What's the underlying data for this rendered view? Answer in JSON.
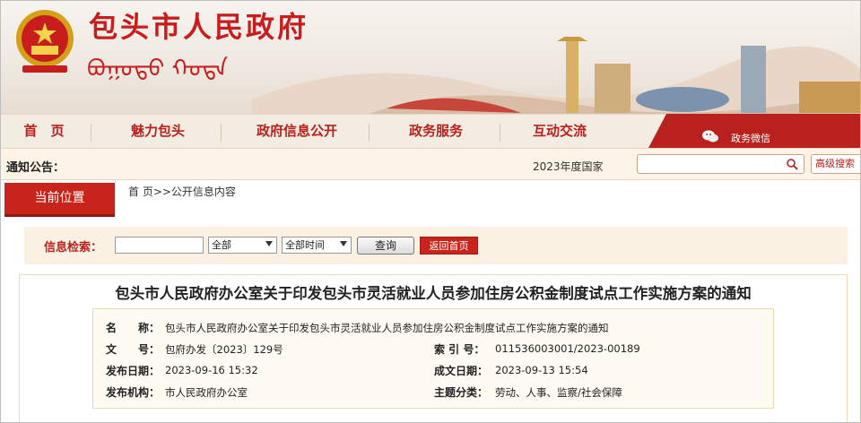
{
  "header": {
    "title": "包头市人民政府",
    "subtitle": "ᠪᠤᠭᠤᠲᠤ ᠬᠣᠲᠠ"
  },
  "nav": {
    "items": [
      {
        "label": "首　页"
      },
      {
        "label": "魅力包头"
      },
      {
        "label": "政府信息公开"
      },
      {
        "label": "政务服务"
      },
      {
        "label": "互动交流"
      }
    ],
    "wechat_label": "政务微信"
  },
  "notice": {
    "label": "通知公告：",
    "text": "2023年度国家",
    "search_placeholder": "",
    "advanced_search": "高级搜索"
  },
  "position": {
    "tag": "当前位置",
    "breadcrumb": "首 页>>公开信息内容"
  },
  "search_row": {
    "label": "信息检索：",
    "input_value": "",
    "category_select": "全部",
    "time_select": "全部时间",
    "query_button": "查询",
    "home_button": "返回首页"
  },
  "article": {
    "title": "包头市人民政府办公室关于印发包头市灵活就业人员参加住房公积金制度试点工作实施方案的通知",
    "meta": {
      "name_label": "名　　称：",
      "name_value": "包头市人民政府办公室关于印发包头市灵活就业人员参加住房公积金制度试点工作实施方案的通知",
      "docno_label": "文　　号：",
      "docno_value": "包府办发〔2023〕129号",
      "index_label": "索 引 号：",
      "index_value": "011536003001/2023-00189",
      "pubdate_label": "发布日期：",
      "pubdate_value": "2023-09-16 15:32",
      "createdate_label": "成文日期：",
      "createdate_value": "2023-09-13 15:54",
      "org_label": "发布机构：",
      "org_value": "市人民政府办公室",
      "topic_label": "主题分类：",
      "topic_value": "劳动、人事、监察/社会保障"
    }
  },
  "colors": {
    "brand_red": "#c8241c",
    "nav_bg": "#f3ece2",
    "notice_bg": "#fdf3e6"
  }
}
